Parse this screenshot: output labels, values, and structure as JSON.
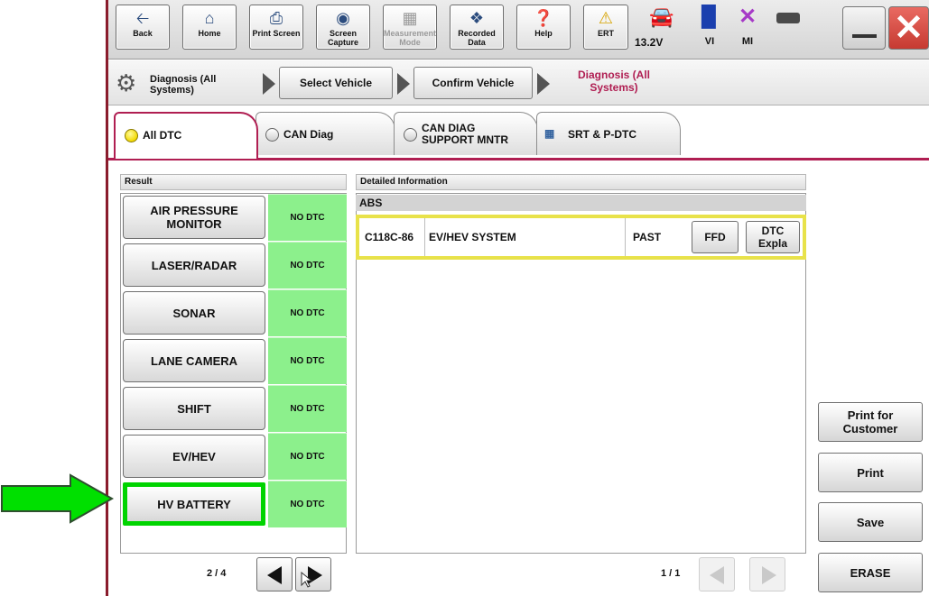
{
  "toolbar": {
    "back": "Back",
    "home": "Home",
    "print_screen": "Print Screen",
    "screen_capture": "Screen Capture",
    "measurement_mode": "Measurement Mode",
    "recorded_data": "Recorded Data",
    "help": "Help",
    "ert": "ERT",
    "voltage": "13.2V",
    "vi": "VI",
    "mi": "MI"
  },
  "breadcrumb": {
    "diagnosis_all": "Diagnosis (All Systems)",
    "select_vehicle": "Select Vehicle",
    "confirm_vehicle": "Confirm Vehicle",
    "current": "Diagnosis (All Systems)"
  },
  "tabs": [
    {
      "label": "All DTC",
      "active": true
    },
    {
      "label": "CAN Diag",
      "active": false
    },
    {
      "label": "CAN DIAG SUPPORT MNTR",
      "active": false
    },
    {
      "label": "SRT & P-DTC",
      "active": false
    }
  ],
  "result": {
    "header": "Result",
    "systems": [
      {
        "name": "AIR PRESSURE MONITOR",
        "status": "NO DTC"
      },
      {
        "name": "LASER/RADAR",
        "status": "NO DTC"
      },
      {
        "name": "SONAR",
        "status": "NO DTC"
      },
      {
        "name": "LANE CAMERA",
        "status": "NO DTC"
      },
      {
        "name": "SHIFT",
        "status": "NO DTC"
      },
      {
        "name": "EV/HEV",
        "status": "NO DTC"
      },
      {
        "name": "HV BATTERY",
        "status": "NO DTC",
        "highlighted": true
      }
    ],
    "page": "2 / 4"
  },
  "detail": {
    "header": "Detailed Information",
    "module": "ABS",
    "dtc_code": "C118C-86",
    "dtc_name": "EV/HEV SYSTEM",
    "dtc_status": "PAST",
    "ffd_label": "FFD",
    "explain_label": "DTC Expla",
    "page": "1 / 1"
  },
  "actions": {
    "print_customer": "Print for Customer",
    "print": "Print",
    "save": "Save",
    "erase": "ERASE"
  },
  "colors": {
    "accent": "#b01e52",
    "no_dtc_green": "#8cf08c",
    "highlight_green": "#00d400",
    "dtc_row_yellow": "#e8e24a"
  }
}
